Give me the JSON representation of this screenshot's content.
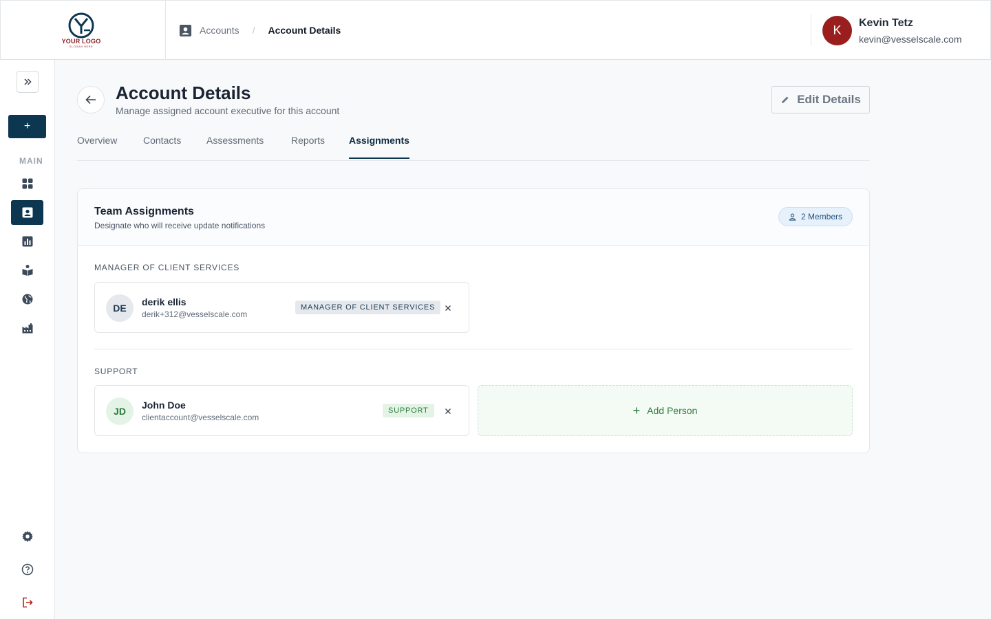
{
  "logo": {
    "text": "YOUR LOGO",
    "tagline": "SLOGAN HERE"
  },
  "breadcrumb": {
    "parent": "Accounts",
    "separator": "/",
    "current": "Account Details"
  },
  "user": {
    "initial": "K",
    "name": "Kevin Tetz",
    "email": "kevin@vesselscale.com"
  },
  "sidebar": {
    "add_label": "+",
    "section_label": "MAIN",
    "items": [
      {
        "name": "dashboard",
        "icon": "grid-icon",
        "active": false
      },
      {
        "name": "accounts",
        "icon": "contact-card-icon",
        "active": true
      },
      {
        "name": "reports",
        "icon": "bar-chart-icon",
        "active": false
      },
      {
        "name": "learning",
        "icon": "book-reader-icon",
        "active": false
      },
      {
        "name": "global",
        "icon": "globe-icon",
        "active": false
      },
      {
        "name": "industry",
        "icon": "factory-icon",
        "active": false
      }
    ],
    "footer": [
      {
        "name": "settings",
        "icon": "gear-icon"
      },
      {
        "name": "help",
        "icon": "help-circle-icon"
      },
      {
        "name": "logout",
        "icon": "logout-icon"
      }
    ]
  },
  "page": {
    "title": "Account Details",
    "subtitle": "Manage assigned account executive for this account",
    "edit_label": "Edit Details"
  },
  "tabs": [
    {
      "label": "Overview",
      "active": false
    },
    {
      "label": "Contacts",
      "active": false
    },
    {
      "label": "Assessments",
      "active": false
    },
    {
      "label": "Reports",
      "active": false
    },
    {
      "label": "Assignments",
      "active": true
    }
  ],
  "card": {
    "title": "Team Assignments",
    "subtitle": "Designate who will receive update notifications",
    "members_badge": "2 Members"
  },
  "sections": [
    {
      "label": "MANAGER OF CLIENT SERVICES",
      "people": [
        {
          "initials": "DE",
          "name": "derik ellis",
          "email": "derik+312@vesselscale.com",
          "role": "MANAGER OF CLIENT SERVICES"
        }
      ]
    },
    {
      "label": "SUPPORT",
      "people": [
        {
          "initials": "JD",
          "name": "John Doe",
          "email": "clientaccount@vesselscale.com",
          "role": "SUPPORT"
        }
      ],
      "add_label": "Add Person"
    }
  ],
  "colors": {
    "primary": "#0d3651",
    "danger": "#9a1e1e",
    "success": "#2b7a3a",
    "info": "#23547e"
  }
}
